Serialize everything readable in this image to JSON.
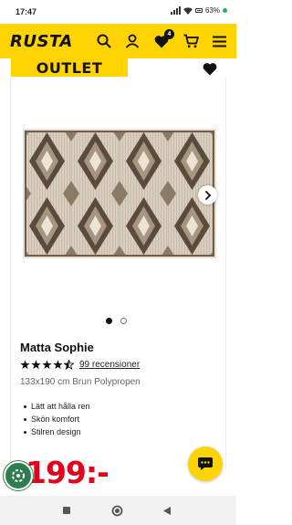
{
  "status_bar": {
    "time": "17:47",
    "battery": "63%"
  },
  "header": {
    "logo": "RUSTA",
    "wishlist_count": "4"
  },
  "banner": {
    "label": "OUTLET"
  },
  "product": {
    "name": "Matta Sophie",
    "rating": 4.5,
    "reviews": "99 recensioner",
    "spec": "133x190 cm Brun Polypropen",
    "features": [
      "Lätt att hålla ren",
      "Skön komfort",
      "Stilren design"
    ],
    "price": "199:-"
  },
  "colors": {
    "brand_yellow": "#ffd300",
    "price_red": "#e2001a",
    "eco_green": "#2e7d4f"
  },
  "icons": [
    "search-icon",
    "user-icon",
    "heart-icon",
    "cart-icon",
    "menu-icon",
    "chevron-right-icon",
    "chat-icon",
    "eco-badge-icon"
  ]
}
